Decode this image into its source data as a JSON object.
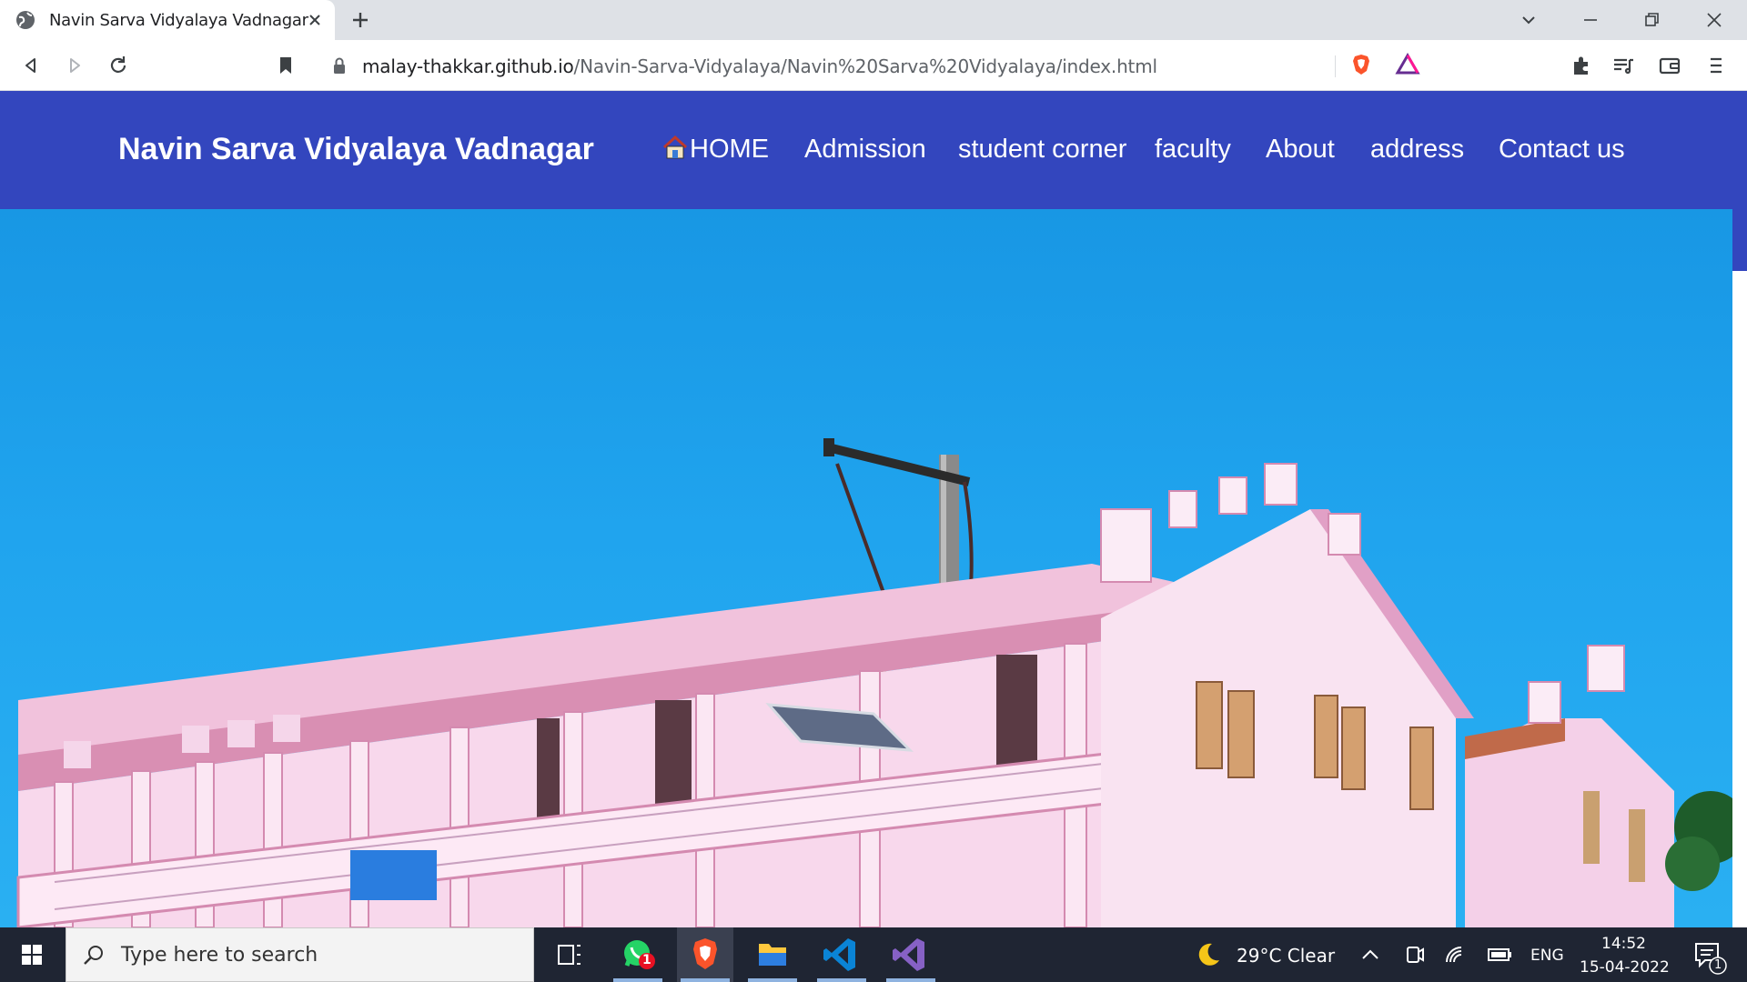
{
  "browser": {
    "tab_title": "Navin Sarva Vidyalaya Vadnagar",
    "url_host": "malay-thakkar.github.io",
    "url_path": "/Navin-Sarva-Vidyalaya/Navin%20Sarva%20Vidyalaya/index.html"
  },
  "site": {
    "brand": "Navin Sarva Vidyalaya Vadnagar",
    "nav": [
      {
        "label": "HOME",
        "icon": "house-icon"
      },
      {
        "label": "Admission"
      },
      {
        "label": "student corner"
      },
      {
        "label": "faculty"
      },
      {
        "label": "About"
      },
      {
        "label": "address"
      },
      {
        "label": "Contact us"
      }
    ],
    "hero_image": "school-building-photo",
    "colors": {
      "navbar": "#3346be",
      "sky": "#20a4ee",
      "building": "#f7d9ee"
    }
  },
  "taskbar": {
    "search_placeholder": "Type here to search",
    "whatsapp_badge": "1",
    "weather": "29°C  Clear",
    "language": "ENG",
    "time": "14:52",
    "date": "15-04-2022",
    "notification_count": "1"
  }
}
